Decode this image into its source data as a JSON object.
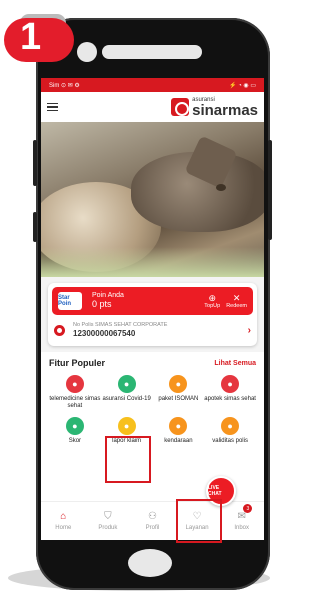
{
  "step": {
    "number": "1"
  },
  "status_bar": {
    "left": "Sim ⊙ ✉ ⚙",
    "right": "⚡ ◔ ◉ ▭"
  },
  "header": {
    "brand_small": "asuransi",
    "brand_name": "sinarmas"
  },
  "poin": {
    "logo_text": "Star Poin",
    "label": "Poin Anda",
    "value": "0 pts",
    "topup_label": "TopUp",
    "redeem_label": "Redeem"
  },
  "polis": {
    "label": "No Polis SIMAS SEHAT CORPORATE",
    "number": "12300000067540"
  },
  "fitur": {
    "title": "Fitur Populer",
    "see_all": "Lihat Semua",
    "items": [
      {
        "label": "telemedicine simas sehat",
        "icon": "telemedicine-icon",
        "color": "#e5363f"
      },
      {
        "label": "asuransi Covid-19",
        "icon": "virus-icon",
        "color": "#2bb673"
      },
      {
        "label": "paket ISOMAN",
        "icon": "package-icon",
        "color": "#f7941d"
      },
      {
        "label": "apotek simas sehat",
        "icon": "pharmacy-icon",
        "color": "#e5363f"
      },
      {
        "label": "Skor",
        "icon": "score-icon",
        "color": "#2bb673"
      },
      {
        "label": "lapor klaim",
        "icon": "claim-report-icon",
        "color": "#f7c01d"
      },
      {
        "label": "kendaraan",
        "icon": "vehicle-icon",
        "color": "#f7941d"
      },
      {
        "label": "validitas polis",
        "icon": "policy-validity-icon",
        "color": "#f7941d"
      }
    ]
  },
  "nav": {
    "items": [
      {
        "label": "Home",
        "icon": "home-icon"
      },
      {
        "label": "Produk",
        "icon": "product-icon"
      },
      {
        "label": "Profil",
        "icon": "profile-icon"
      },
      {
        "label": "Layanan",
        "icon": "service-icon"
      },
      {
        "label": "Inbox",
        "icon": "inbox-icon"
      }
    ],
    "inbox_badge": "3"
  },
  "fab": {
    "label": "LIVE CHAT",
    "icon": "chat-icon"
  },
  "colors": {
    "brand": "#d71920",
    "accent": "#ec1c24"
  }
}
